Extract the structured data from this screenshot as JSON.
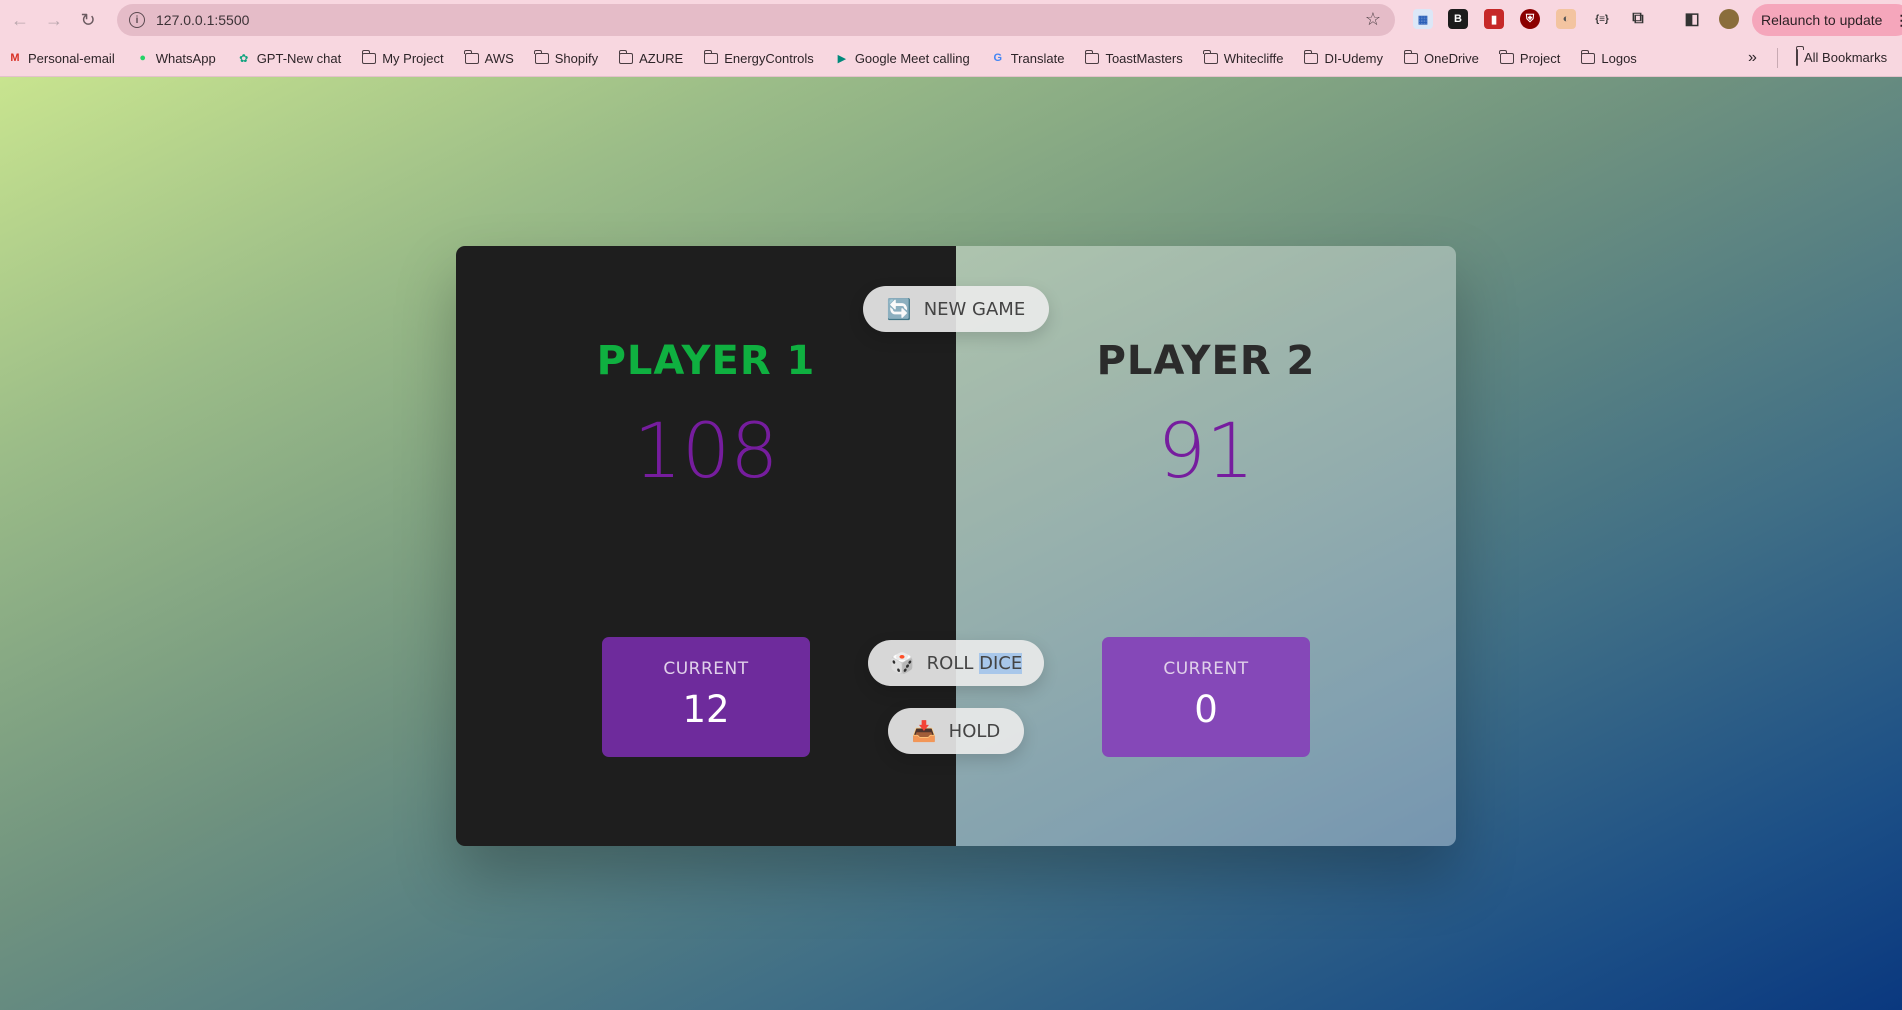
{
  "browser": {
    "url": "127.0.0.1:5500",
    "relaunch_label": "Relaunch to update",
    "bookmarks": [
      {
        "label": "Personal-email",
        "icon": "gmail-icon"
      },
      {
        "label": "WhatsApp",
        "icon": "whatsapp-icon"
      },
      {
        "label": "GPT-New chat",
        "icon": "chatgpt-icon"
      },
      {
        "label": "My Project",
        "icon": "folder-icon"
      },
      {
        "label": "AWS",
        "icon": "folder-icon"
      },
      {
        "label": "Shopify",
        "icon": "folder-icon"
      },
      {
        "label": "AZURE",
        "icon": "folder-icon"
      },
      {
        "label": "EnergyControls",
        "icon": "folder-icon"
      },
      {
        "label": "Google Meet calling",
        "icon": "google-meet-icon"
      },
      {
        "label": "Translate",
        "icon": "google-translate-icon"
      },
      {
        "label": "ToastMasters",
        "icon": "folder-icon"
      },
      {
        "label": "Whitecliffe",
        "icon": "folder-icon"
      },
      {
        "label": "DI-Udemy",
        "icon": "folder-icon"
      },
      {
        "label": "OneDrive",
        "icon": "folder-icon"
      },
      {
        "label": "Project",
        "icon": "folder-icon"
      },
      {
        "label": "Logos",
        "icon": "folder-icon"
      }
    ],
    "all_bookmarks_label": "All Bookmarks"
  },
  "game": {
    "player1": {
      "name": "PLAYER 1",
      "score": "108",
      "current_label": "CURRENT",
      "current_score": "12"
    },
    "player2": {
      "name": "PLAYER 2",
      "score": "91",
      "current_label": "CURRENT",
      "current_score": "0"
    },
    "buttons": {
      "new_game": {
        "emoji": "🔄",
        "label": "NEW GAME"
      },
      "roll_dice": {
        "emoji": "🎲",
        "label_part1": "ROLL ",
        "label_part2": "DICE"
      },
      "hold": {
        "emoji": "📥",
        "label": "HOLD"
      }
    }
  },
  "colors": {
    "active_player_name": "#0fb040",
    "score": "#761d9e",
    "current_box_p1": "#6e2b9c",
    "current_box_p2": "#8548b8"
  }
}
